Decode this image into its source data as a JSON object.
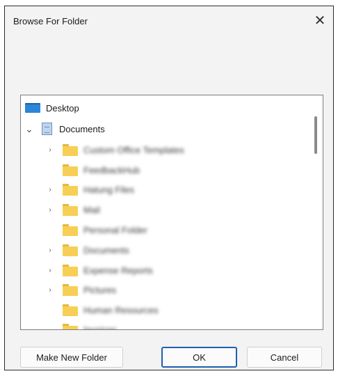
{
  "window": {
    "title": "Browse For Folder",
    "close_glyph": "✕"
  },
  "tree": {
    "root": {
      "label": "Desktop",
      "icon": "desktop-icon"
    },
    "documents": {
      "label": "Documents",
      "icon": "documents-icon",
      "expanded": true,
      "expander": "⌄"
    },
    "children": [
      {
        "label": "Custom Office Templates",
        "has_children": true
      },
      {
        "label": "FeedbackHub",
        "has_children": false
      },
      {
        "label": "Hatung Files",
        "has_children": true
      },
      {
        "label": "Mail",
        "has_children": true
      },
      {
        "label": "Personal Folder",
        "has_children": false
      },
      {
        "label": "Documents",
        "has_children": true
      },
      {
        "label": "Expense Reports",
        "has_children": true
      },
      {
        "label": "Pictures",
        "has_children": true
      },
      {
        "label": "Human Resources",
        "has_children": false
      },
      {
        "label": "Invoices",
        "has_children": false
      }
    ],
    "child_expander": "›"
  },
  "buttons": {
    "make_new_folder": "Make New Folder",
    "ok": "OK",
    "cancel": "Cancel"
  },
  "colors": {
    "folder": "#f7cf56",
    "accent": "#1f5fb0"
  }
}
